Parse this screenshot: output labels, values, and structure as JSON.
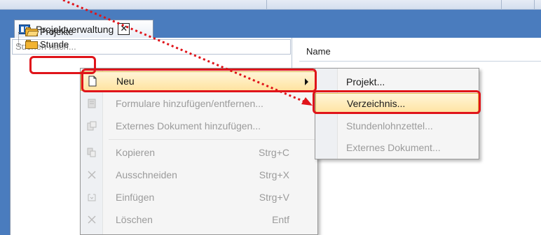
{
  "window": {
    "tab_label": "Projektverwaltung",
    "close_glyph": "✕"
  },
  "left_pane": {
    "search_placeholder": "Suchen nach...",
    "tree": [
      {
        "label": "Projekte",
        "icon": "folder-open-icon"
      },
      {
        "label": "Stunde",
        "icon": "folder-icon"
      }
    ]
  },
  "right_pane": {
    "column_header": "Name"
  },
  "context_menu": {
    "items": [
      {
        "label": "Neu",
        "shortcut": "",
        "icon": "new-document-icon",
        "enabled": true,
        "highlighted": true,
        "submenu": true
      },
      {
        "label": "Formulare hinzufügen/entfernen...",
        "shortcut": "",
        "icon": "forms-icon",
        "enabled": false
      },
      {
        "label": "Externes Dokument hinzufügen...",
        "shortcut": "",
        "icon": "external-doc-icon",
        "enabled": false
      },
      {
        "label": "Kopieren",
        "shortcut": "Strg+C",
        "icon": "copy-icon",
        "enabled": false
      },
      {
        "label": "Ausschneiden",
        "shortcut": "Strg+X",
        "icon": "cut-icon",
        "enabled": false
      },
      {
        "label": "Einfügen",
        "shortcut": "Strg+V",
        "icon": "paste-icon",
        "enabled": false
      },
      {
        "label": "Löschen",
        "shortcut": "Entf",
        "icon": "delete-icon",
        "enabled": false
      }
    ]
  },
  "submenu": {
    "items": [
      {
        "label": "Projekt...",
        "enabled": true
      },
      {
        "label": "Verzeichnis...",
        "enabled": true,
        "highlighted": true
      },
      {
        "label": "Stundenlohnzettel...",
        "enabled": false
      },
      {
        "label": "Externes Dokument...",
        "enabled": false
      }
    ]
  },
  "colors": {
    "background": "#4a7cbe",
    "highlight_annotation": "#e0141a",
    "menu_highlight": "#ffe3a0"
  }
}
